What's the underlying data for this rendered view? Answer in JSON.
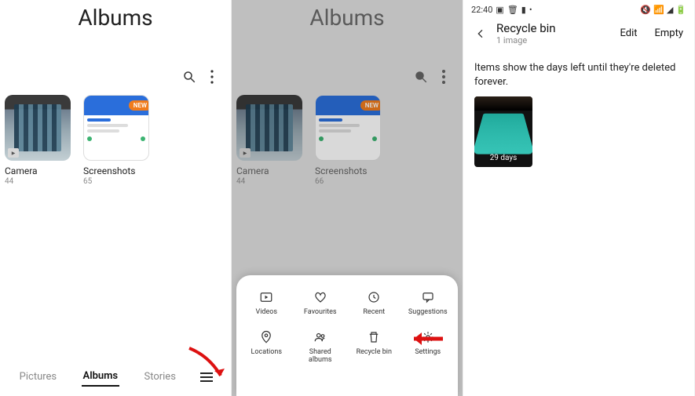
{
  "panel1": {
    "title": "Albums",
    "albums": [
      {
        "name": "Camera",
        "count": "44"
      },
      {
        "name": "Screenshots",
        "count": "65",
        "new_badge": "NEW"
      }
    ],
    "tabs": {
      "pictures": "Pictures",
      "albums": "Albums",
      "stories": "Stories"
    }
  },
  "panel2": {
    "title": "Albums",
    "albums": [
      {
        "name": "Camera",
        "count": "44"
      },
      {
        "name": "Screenshots",
        "count": "66",
        "new_badge": "NEW"
      }
    ],
    "sheet": {
      "videos": "Videos",
      "favourites": "Favourites",
      "recent": "Recent",
      "suggestions": "Suggestions",
      "locations": "Locations",
      "shared_albums": "Shared\nalbums",
      "recycle_bin": "Recycle bin",
      "settings": "Settings"
    }
  },
  "panel3": {
    "status": {
      "time": "22:40",
      "right_icons": "◢"
    },
    "header": {
      "title": "Recycle bin",
      "subtitle": "1 image",
      "edit": "Edit",
      "empty": "Empty"
    },
    "message": "Items show the days left until they're deleted forever.",
    "thumb": {
      "days_left": "29 days"
    }
  }
}
